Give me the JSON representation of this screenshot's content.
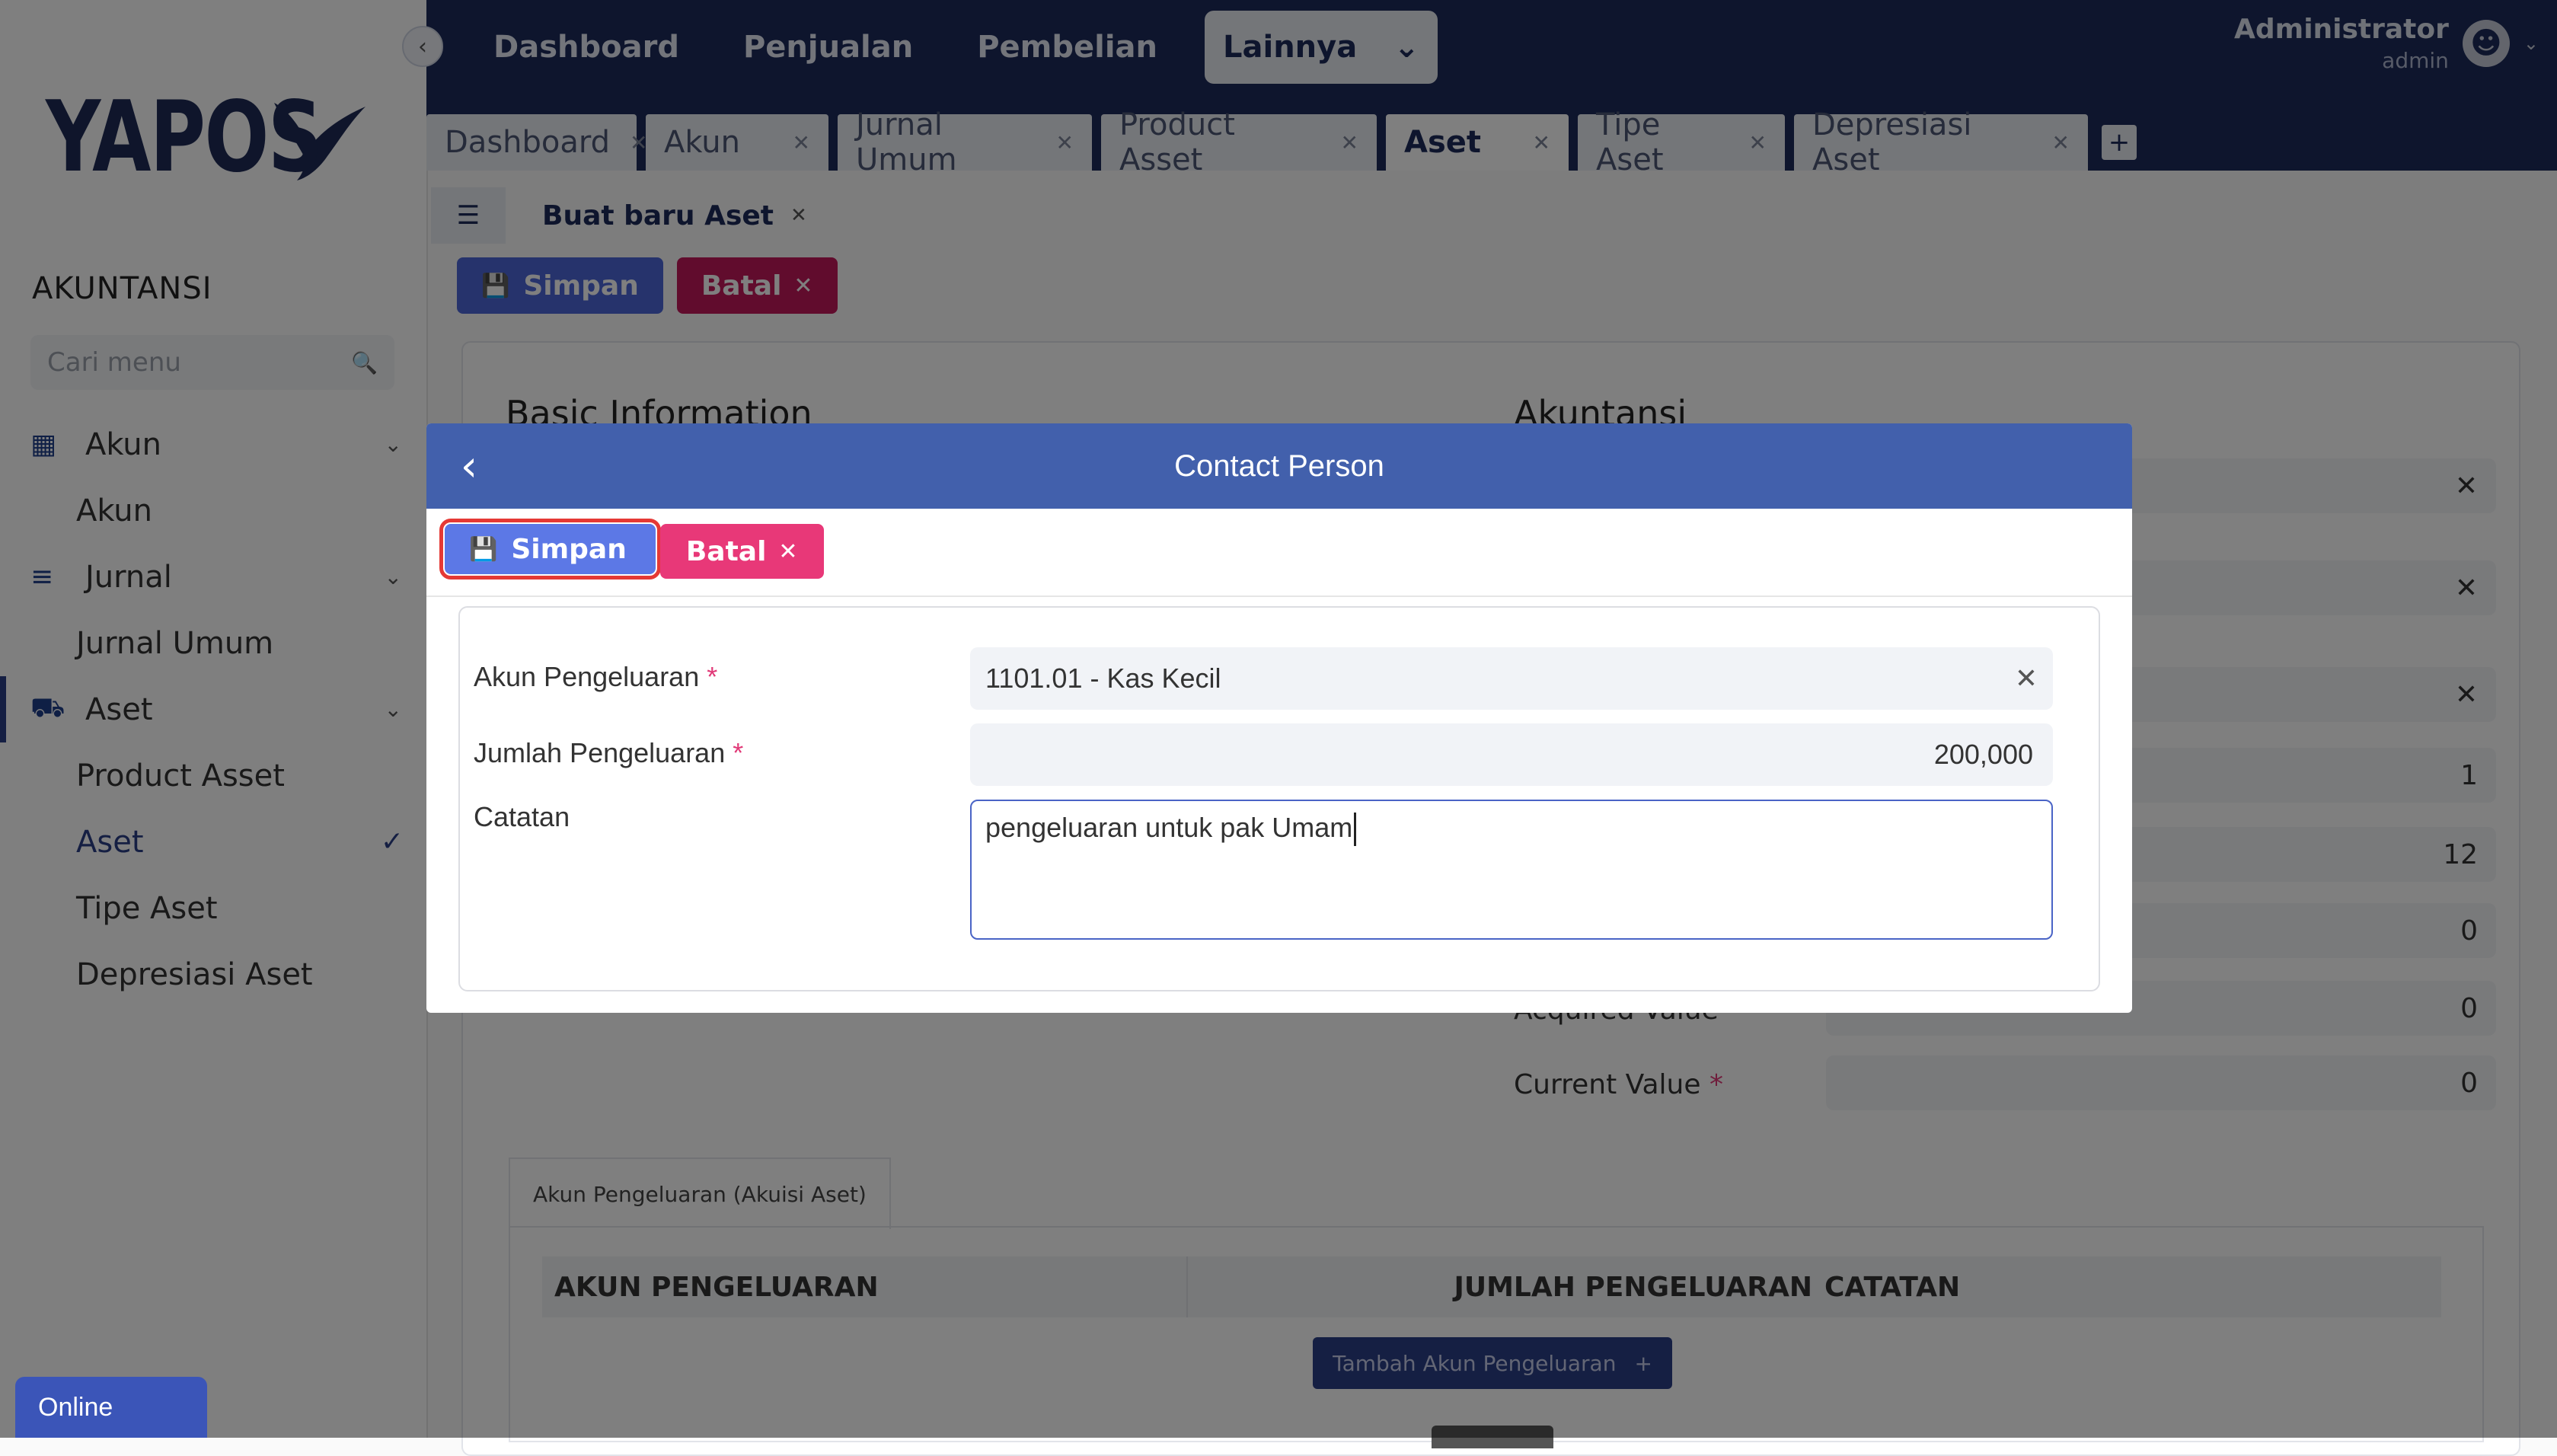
{
  "sidebar": {
    "logo_text": "YAPOS",
    "section_title": "AKUNTANSI",
    "search_placeholder": "Cari menu",
    "groups": [
      {
        "label": "Akun",
        "items": [
          "Akun"
        ]
      },
      {
        "label": "Jurnal",
        "items": [
          "Jurnal Umum"
        ]
      },
      {
        "label": "Aset",
        "items": [
          "Product Asset",
          "Aset",
          "Tipe Aset",
          "Depresiasi Aset"
        ],
        "active_item": "Aset"
      }
    ]
  },
  "topnav": {
    "items": [
      "Dashboard",
      "Penjualan",
      "Pembelian"
    ],
    "dropdown_label": "Lainnya",
    "user": {
      "name": "Administrator",
      "role": "admin"
    }
  },
  "tabs": [
    {
      "label": "Dashboard"
    },
    {
      "label": "Akun"
    },
    {
      "label": "Jurnal Umum"
    },
    {
      "label": "Product Asset"
    },
    {
      "label": "Aset",
      "active": true
    },
    {
      "label": "Tipe Aset"
    },
    {
      "label": "Depresiasi Aset"
    }
  ],
  "content_tab": {
    "label": "Buat baru Aset"
  },
  "page_actions": {
    "save_label": "Simpan",
    "cancel_label": "Batal"
  },
  "background_form": {
    "basic_heading": "Basic Information",
    "akuntansi_heading": "Akuntansi",
    "values": [
      "1",
      "12",
      "0",
      "0",
      "0"
    ],
    "acquired_label": "Acquired Value",
    "current_label": "Current Value",
    "sub_tab_label": "Akun Pengeluaran (Akuisi Aset)",
    "grid_headers": [
      "AKUN PENGELUARAN",
      "JUMLAH PENGELUARAN",
      "CATATAN"
    ],
    "add_row_label": "Tambah Akun Pengeluaran"
  },
  "modal": {
    "title": "Contact Person",
    "save_label": "Simpan",
    "cancel_label": "Batal",
    "fields": {
      "akun_label": "Akun Pengeluaran",
      "akun_value": "1101.01 - Kas Kecil",
      "jumlah_label": "Jumlah Pengeluaran",
      "jumlah_value": "200,000",
      "catatan_label": "Catatan",
      "catatan_value": "pengeluaran untuk pak Umam"
    }
  },
  "status": {
    "online_label": "Online"
  },
  "colors": {
    "primary": "#1c2a5a",
    "modal_header": "#4260ac",
    "save": "#5c78e6",
    "cancel": "#e83878",
    "highlight": "#e53935"
  }
}
